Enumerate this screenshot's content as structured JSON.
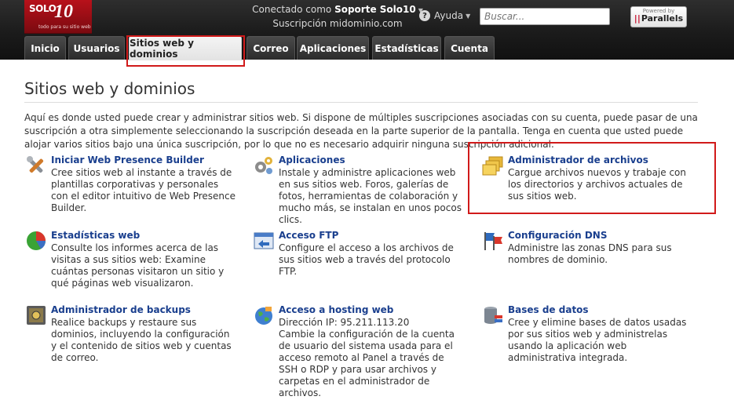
{
  "logo": {
    "main": "SOLO",
    "number": "10",
    "tagline": "todo para su sitio web"
  },
  "header": {
    "connected_prefix": "Conectado como",
    "user": "Soporte Solo10",
    "subscription_line": "Suscripción midominio.com",
    "help_label": "Ayuda",
    "search_placeholder": "Buscar...",
    "powered_by": "Powered by",
    "parallels": "Parallels"
  },
  "tabs": [
    {
      "label": "Inicio",
      "active": false
    },
    {
      "label": "Usuarios",
      "active": false
    },
    {
      "label": "Sitios web y dominios",
      "active": true
    },
    {
      "label": "Correo",
      "active": false
    },
    {
      "label": "Aplicaciones",
      "active": false
    },
    {
      "label": "Estadísticas",
      "active": false
    },
    {
      "label": "Cuenta",
      "active": false
    }
  ],
  "page": {
    "title": "Sitios web y dominios",
    "intro": "Aquí es donde usted puede crear y administrar sitios web. Si dispone de múltiples suscripciones asociadas con su cuenta, puede pasar de una suscripción a otra simplemente seleccionando la suscripción deseada en la parte superior de la pantalla. Tenga en cuenta que usted puede alojar varios sitios bajo una única suscripción, por lo que no es necesario adquirir ninguna suscripción adicional."
  },
  "items": [
    {
      "icon": "wrench-icon",
      "title": "Iniciar Web Presence Builder",
      "desc": "Cree sitios web al instante a través de plantillas corporativas y personales con el editor intuitivo de Web Presence Builder."
    },
    {
      "icon": "gears-icon",
      "title": "Aplicaciones",
      "desc": "Instale y administre aplicaciones web en sus sitios web. Foros, galerías de fotos, herramientas de colaboración y mucho más, se instalan en unos pocos clics."
    },
    {
      "icon": "folders-icon",
      "title": "Administrador de archivos",
      "desc": "Cargue archivos nuevos y trabaje con los directorios y archivos actuales de sus sitios web."
    },
    {
      "icon": "pie-chart-icon",
      "title": "Estadísticas web",
      "desc": "Consulte los informes acerca de las visitas a sus sitios web: Examine cuántas personas visitaron un sitio y qué páginas web visualizaron."
    },
    {
      "icon": "ftp-window-icon",
      "title": "Acceso FTP",
      "desc": "Configure el acceso a los archivos de sus sitios web a través del protocolo FTP."
    },
    {
      "icon": "flags-icon",
      "title": "Configuración DNS",
      "desc": "Administre las zonas DNS para sus nombres de dominio."
    },
    {
      "icon": "safe-icon",
      "title": "Administrador de backups",
      "desc": "Realice backups y restaure sus dominios, incluyendo la configuración y el contenido de sitios web y cuentas de correo."
    },
    {
      "icon": "globe-icon",
      "title": "Acceso a hosting web",
      "desc": "Dirección IP: 95.211.113.20\nCambie la configuración de la cuenta de usuario del sistema usada para el acceso remoto al Panel a través de SSH o RDP y para usar archivos y carpetas en el administrador de archivos."
    },
    {
      "icon": "database-icon",
      "title": "Bases de datos",
      "desc": "Cree y elimine bases de datos usadas por sus sitios web y administrelas usando la aplicación web administrativa integrada."
    }
  ],
  "colors": {
    "link": "#1a3f8e",
    "highlight": "#d11a1a",
    "header_bg": "#1b1b1b",
    "logo_red": "#b8111a"
  }
}
